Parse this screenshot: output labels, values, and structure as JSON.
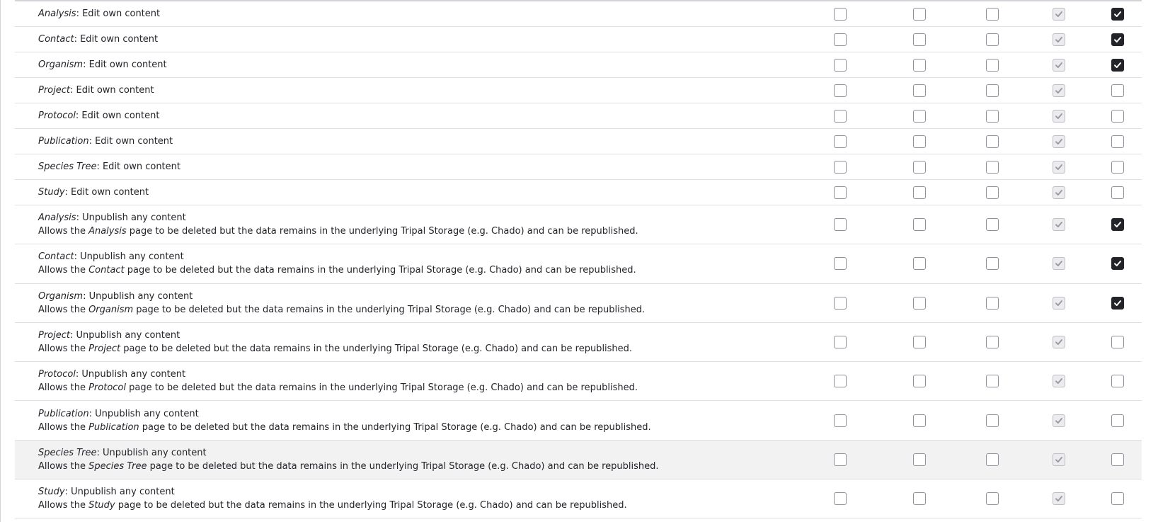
{
  "desc_prefix": "Allows the",
  "desc_suffix": "page to be deleted but the data remains in the underlying Tripal Storage (e.g. Chado) and can be republished.",
  "rows": [
    {
      "entity": "Analysis",
      "perm": ": Edit own content",
      "checks": [
        false,
        false,
        false,
        true,
        true
      ]
    },
    {
      "entity": "Contact",
      "perm": ": Edit own content",
      "checks": [
        false,
        false,
        false,
        true,
        true
      ]
    },
    {
      "entity": "Organism",
      "perm": ": Edit own content",
      "checks": [
        false,
        false,
        false,
        true,
        true
      ]
    },
    {
      "entity": "Project",
      "perm": ": Edit own content",
      "checks": [
        false,
        false,
        false,
        true,
        false
      ]
    },
    {
      "entity": "Protocol",
      "perm": ": Edit own content",
      "checks": [
        false,
        false,
        false,
        true,
        false
      ]
    },
    {
      "entity": "Publication",
      "perm": ": Edit own content",
      "checks": [
        false,
        false,
        false,
        true,
        false
      ]
    },
    {
      "entity": "Species Tree",
      "perm": ": Edit own content",
      "checks": [
        false,
        false,
        false,
        true,
        false
      ]
    },
    {
      "entity": "Study",
      "perm": ": Edit own content",
      "checks": [
        false,
        false,
        false,
        true,
        false
      ]
    },
    {
      "entity": "Analysis",
      "perm": ": Unpublish any content",
      "desc": true,
      "checks": [
        false,
        false,
        false,
        true,
        true
      ]
    },
    {
      "entity": "Contact",
      "perm": ": Unpublish any content",
      "desc": true,
      "checks": [
        false,
        false,
        false,
        true,
        true
      ]
    },
    {
      "entity": "Organism",
      "perm": ": Unpublish any content",
      "desc": true,
      "checks": [
        false,
        false,
        false,
        true,
        true
      ]
    },
    {
      "entity": "Project",
      "perm": ": Unpublish any content",
      "desc": true,
      "checks": [
        false,
        false,
        false,
        true,
        false
      ]
    },
    {
      "entity": "Protocol",
      "perm": ": Unpublish any content",
      "desc": true,
      "checks": [
        false,
        false,
        false,
        true,
        false
      ]
    },
    {
      "entity": "Publication",
      "perm": ": Unpublish any content",
      "desc": true,
      "checks": [
        false,
        false,
        false,
        true,
        false
      ]
    },
    {
      "entity": "Species Tree",
      "perm": ": Unpublish any content",
      "desc": true,
      "hover": true,
      "checks": [
        false,
        false,
        false,
        true,
        false
      ]
    },
    {
      "entity": "Study",
      "perm": ": Unpublish any content",
      "desc": true,
      "checks": [
        false,
        false,
        false,
        true,
        false
      ]
    }
  ],
  "disabled_column": 3,
  "colors": {
    "checked": "#232429",
    "disabled_check": "#9a9ca3",
    "row_hover": "#f2f2f3"
  }
}
